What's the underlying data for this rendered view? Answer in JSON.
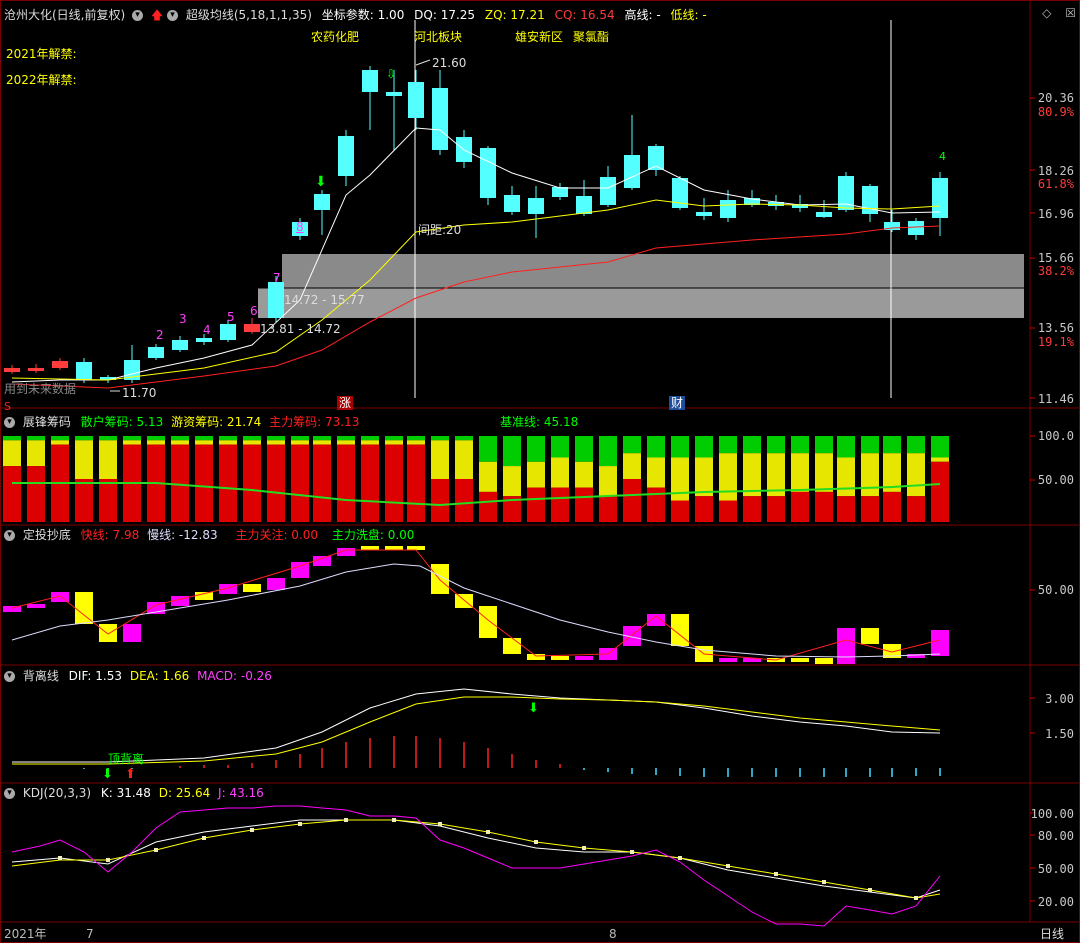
{
  "header": {
    "stock_name": "沧州大化(日线,前复权)",
    "indicator_name": "超级均线(5,18,1,1,35)",
    "coord_label": "坐标参数: 1.00",
    "dq": "DQ: 17.25",
    "zq": "ZQ: 17.21",
    "cq": "CQ: 16.54",
    "high_line": "高线: -",
    "low_line": "低线: -",
    "icons": [
      "diamond-icon",
      "close-icon"
    ]
  },
  "main_panel": {
    "notes": [
      "2021年解禁:",
      "2022年解禁:"
    ],
    "concepts": [
      "农药化肥",
      "河北板块",
      "雄安新区",
      "聚氯酯"
    ],
    "peak_label": "21.60",
    "low_label": "11.70",
    "gap_label": "间距:20",
    "zone1_label": "14.72 - 15.77",
    "zone2_label": "13.81 - 14.72",
    "count_labels": [
      "2",
      "3",
      "4",
      "5",
      "6",
      "7",
      "8"
    ],
    "bottom_left_text": "用到未来数据",
    "event_badges": [
      "涨",
      "财"
    ],
    "s_badge": "S",
    "price_axis": [
      "20.36",
      "80.9%",
      "18.26",
      "61.8%",
      "16.96",
      "15.66",
      "38.2%",
      "13.56",
      "19.1%",
      "11.46"
    ]
  },
  "panel2": {
    "name": "展锋筹码",
    "sanhu": "散户筹码: 5.13",
    "youzi": "游资筹码: 21.74",
    "zhuli": "主力筹码: 73.13",
    "jizhun": "基准线: 45.18",
    "axis": [
      "100.0",
      "50.00"
    ]
  },
  "panel3": {
    "name": "定投抄底",
    "fast": "快线: 7.98",
    "slow": "慢线: -12.83",
    "attention": "主力关注: 0.00",
    "wash": "主力洗盘: 0.00",
    "axis": [
      "50.00"
    ]
  },
  "panel4": {
    "name": "背离线",
    "dif": "DIF: 1.53",
    "dea": "DEA: 1.66",
    "macd": "MACD: -0.26",
    "divergence_label": "顶背离",
    "axis": [
      "3.00",
      "1.50"
    ]
  },
  "panel5": {
    "name": "KDJ(20,3,3)",
    "k": "K: 31.48",
    "d": "D: 25.64",
    "j": "J: 43.16",
    "axis": [
      "100.00",
      "80.00",
      "50.00",
      "20.00"
    ]
  },
  "time_axis": {
    "labels": [
      "2021年",
      "7",
      "8"
    ],
    "period": "日线"
  },
  "colors": {
    "up": "#ff3b3b",
    "down": "#54ffff",
    "yellow": "#ffff00",
    "magenta": "#ff00ff",
    "green": "#00ff00",
    "white": "#ffffff",
    "gray_zone": "#808080",
    "border": "#7a0000"
  }
}
